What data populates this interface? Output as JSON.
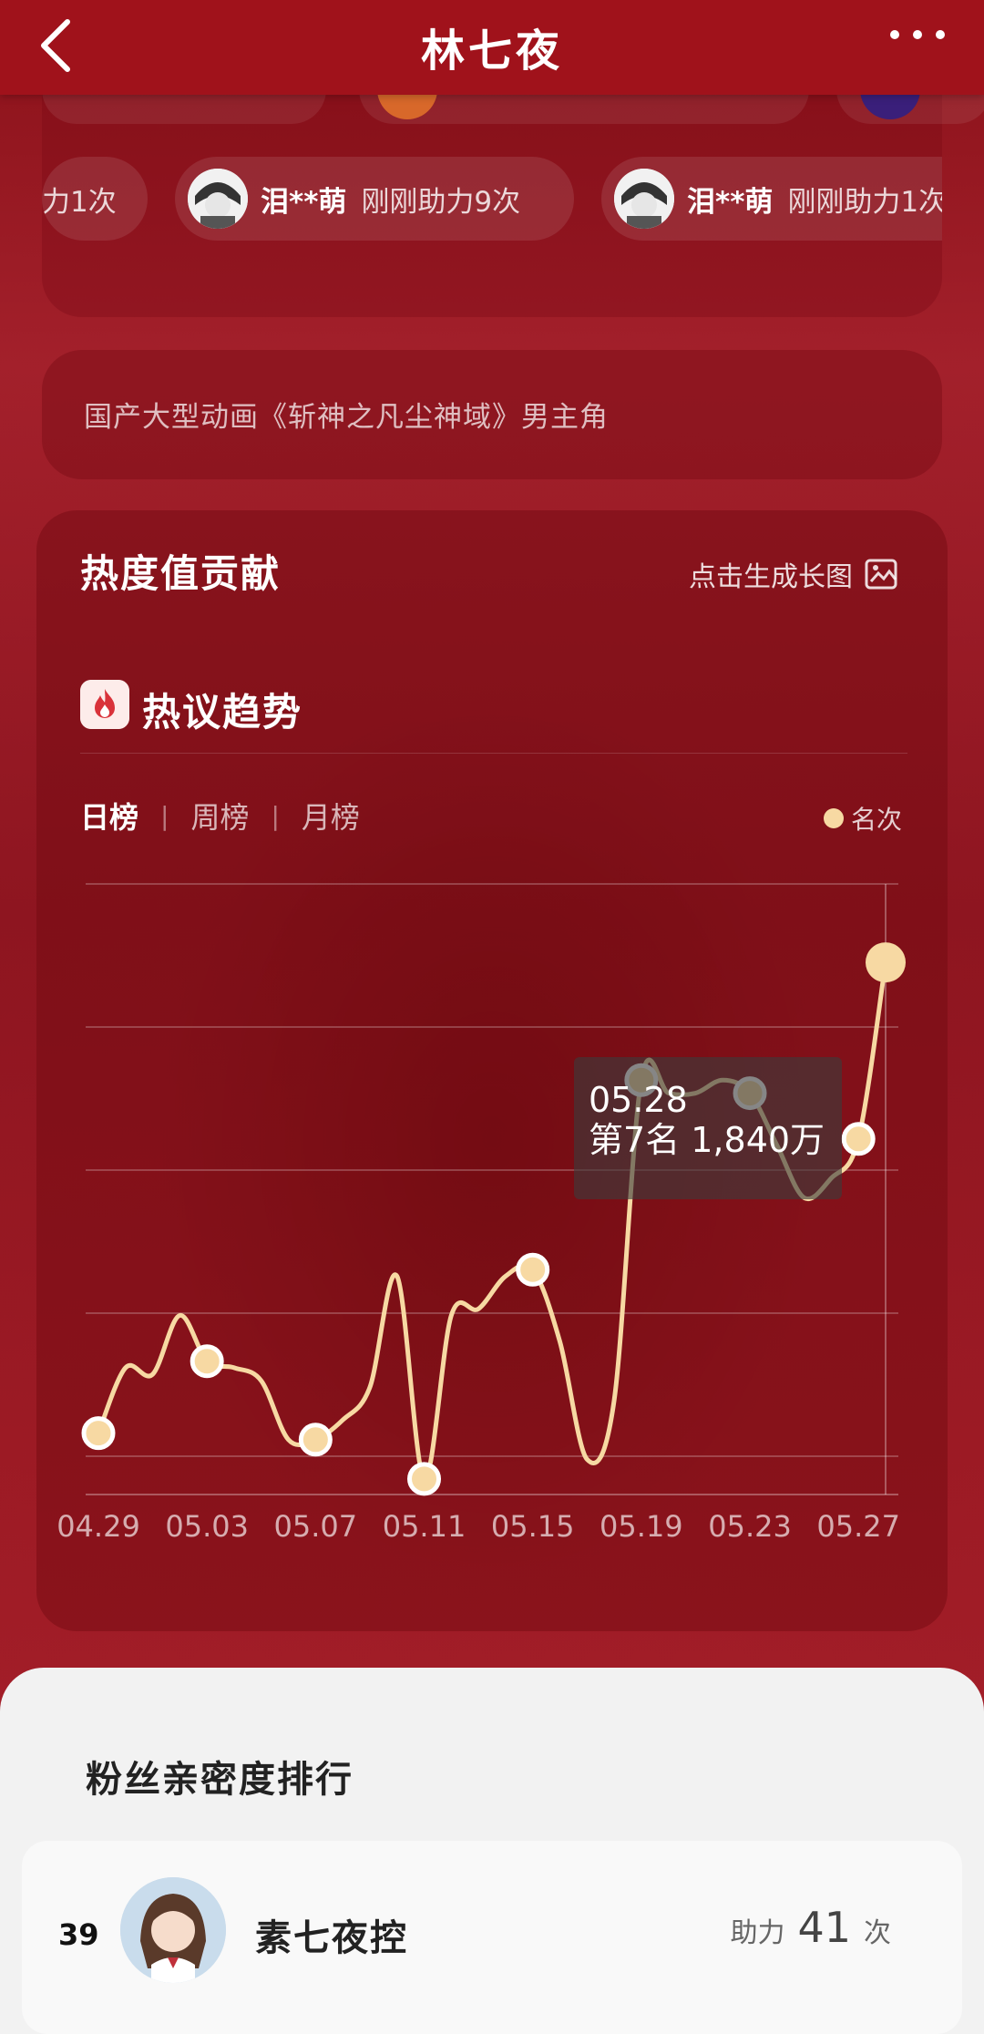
{
  "header": {
    "title": "林七夜"
  },
  "pills_row2": [
    {
      "name": "",
      "text": "力1次"
    },
    {
      "name": "泪**萌",
      "text": "刚刚助力9次"
    },
    {
      "name": "泪**萌",
      "text": "刚刚助力1次"
    }
  ],
  "description": "国产大型动画《斩神之凡尘神域》男主角",
  "contribution": {
    "title": "热度值贡献",
    "long_image": "点击生成长图"
  },
  "trend": {
    "title": "热议趋势",
    "tabs": [
      "日榜",
      "周榜",
      "月榜"
    ],
    "legend": "名次",
    "tooltip_date": "05.28",
    "tooltip_value": "第7名 1,840万"
  },
  "chart_data": {
    "type": "line",
    "series": [
      {
        "name": "名次",
        "x": [
          "04.29",
          "04.30",
          "05.01",
          "05.02",
          "05.03",
          "05.04",
          "05.05",
          "05.06",
          "05.07",
          "05.08",
          "05.09",
          "05.10",
          "05.11",
          "05.12",
          "05.13",
          "05.14",
          "05.15",
          "05.16",
          "05.17",
          "05.18",
          "05.19",
          "05.20",
          "05.21",
          "05.22",
          "05.23",
          "05.24",
          "05.25",
          "05.26",
          "05.27",
          "05.28"
        ],
        "values": [
          8.4,
          7.4,
          7.5,
          6.6,
          7.3,
          7.4,
          7.6,
          8.5,
          8.5,
          8.2,
          7.7,
          6.0,
          9.1,
          6.6,
          6.5,
          6.0,
          5.9,
          7.0,
          8.8,
          7.9,
          3.0,
          3.2,
          3.2,
          3.0,
          3.2,
          4.0,
          4.8,
          4.5,
          3.9,
          1.2
        ]
      }
    ],
    "markers": [
      "04.29",
      "05.03",
      "05.07",
      "05.11",
      "05.15",
      "05.19",
      "05.23",
      "05.27",
      "05.28"
    ],
    "x_tick_labels": [
      "04.29",
      "05.03",
      "05.07",
      "05.11",
      "05.15",
      "05.19",
      "05.23",
      "05.27"
    ],
    "y_inverted": true,
    "grid": true
  },
  "fans": {
    "title": "粉丝亲密度排行",
    "rank": "39",
    "name": "素七夜控",
    "help_label": "助力",
    "help_count": "41",
    "help_unit": "次"
  },
  "colors": {
    "header": "#a0121b",
    "line": "#f7d9a3"
  }
}
